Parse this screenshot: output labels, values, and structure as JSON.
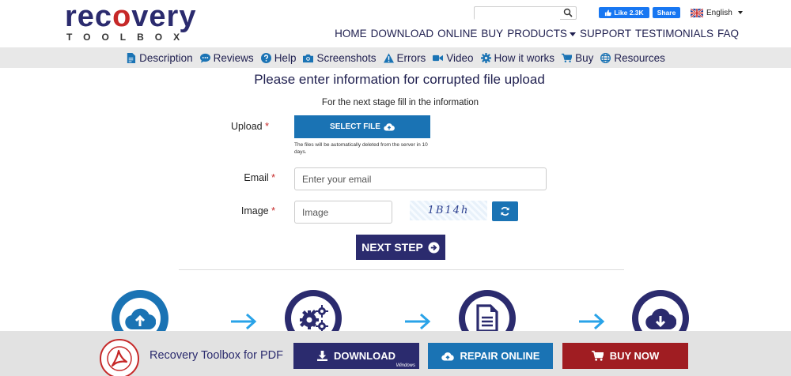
{
  "header": {
    "logo_main": "recovery",
    "logo_sub": "TOOLBOX",
    "search_placeholder": "",
    "fb_like_label": "Like 2.3K",
    "fb_share_label": "Share",
    "language": "English"
  },
  "main_nav": [
    "HOME",
    "DOWNLOAD",
    "ONLINE",
    "BUY",
    "PRODUCTS",
    "SUPPORT",
    "TESTIMONIALS",
    "FAQ"
  ],
  "sub_nav": [
    {
      "label": "Description",
      "icon": "file-icon"
    },
    {
      "label": "Reviews",
      "icon": "chat-icon"
    },
    {
      "label": "Help",
      "icon": "question-icon"
    },
    {
      "label": "Screenshots",
      "icon": "camera-icon"
    },
    {
      "label": "Errors",
      "icon": "warning-icon"
    },
    {
      "label": "Video",
      "icon": "video-icon"
    },
    {
      "label": "How it works",
      "icon": "gear-icon"
    },
    {
      "label": "Buy",
      "icon": "cart-icon"
    },
    {
      "label": "Resources",
      "icon": "globe-icon"
    }
  ],
  "form": {
    "title": "Please enter information for corrupted file upload",
    "subtitle": "For the next stage fill in the information",
    "upload_label": "Upload",
    "select_file_label": "SELECT FILE",
    "file_note": "The files will be automatically deleted from the server in 10 days.",
    "email_label": "Email",
    "email_placeholder": "Enter your email",
    "image_label": "Image",
    "image_placeholder": "Image",
    "captcha_text": "1B14h",
    "next_step_label": "NEXT STEP",
    "required_mark": "*"
  },
  "bottom_bar": {
    "product_name": "Recovery Toolbox for PDF",
    "download_label": "DOWNLOAD",
    "download_platform": "Windows",
    "repair_label": "REPAIR ONLINE",
    "buy_label": "BUY NOW"
  },
  "colors": {
    "navy": "#2b2b6e",
    "blue": "#1a73b4",
    "red": "#a01d22",
    "arrow": "#29a3e8"
  }
}
